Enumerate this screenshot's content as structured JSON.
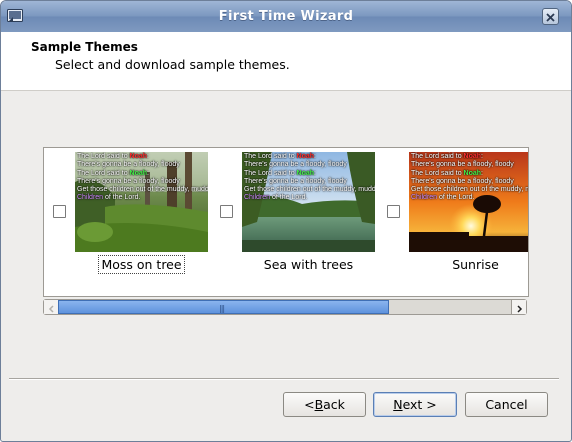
{
  "window": {
    "title": "First Time Wizard",
    "title_icon": "window-icon",
    "close_icon": "close-icon"
  },
  "header": {
    "title": "Sample Themes",
    "subtitle": "Select and download sample themes."
  },
  "themes": [
    {
      "name": "Moss on tree",
      "checked": false,
      "focused": true,
      "lyrics": [
        {
          "parts": [
            {
              "t": "The Lord said to "
            },
            {
              "t": "Noah",
              "c": "red"
            },
            {
              "t": ":"
            }
          ]
        },
        {
          "parts": [
            {
              "t": "There's gonna be a "
            },
            {
              "t": "floody, floody"
            }
          ]
        },
        {
          "parts": [
            {
              "t": "The Lord said to "
            },
            {
              "t": "Noah",
              "c": "green"
            },
            {
              "t": ":"
            }
          ]
        },
        {
          "parts": [
            {
              "t": "There's gonna be a "
            },
            {
              "t": "floody, floody"
            }
          ]
        },
        {
          "parts": [
            {
              "t": "Get those children out of the muddy, muddy"
            }
          ]
        },
        {
          "parts": [
            {
              "t": "Children",
              "c": "purple"
            },
            {
              "t": " of the Lord."
            }
          ]
        }
      ]
    },
    {
      "name": "Sea with trees",
      "checked": false,
      "focused": false,
      "lyrics": [
        {
          "parts": [
            {
              "t": "The Lord said to "
            },
            {
              "t": "Noah",
              "c": "red"
            },
            {
              "t": ":"
            }
          ]
        },
        {
          "parts": [
            {
              "t": "There's gonna be a "
            },
            {
              "t": "floody, floody"
            }
          ]
        },
        {
          "parts": [
            {
              "t": "The Lord said to "
            },
            {
              "t": "Noah",
              "c": "green"
            },
            {
              "t": ":"
            }
          ]
        },
        {
          "parts": [
            {
              "t": "There's gonna be a "
            },
            {
              "t": "floody, floody"
            }
          ]
        },
        {
          "parts": [
            {
              "t": "Get those children out of the muddy, muddy"
            }
          ]
        },
        {
          "parts": [
            {
              "t": "Children",
              "c": "purple"
            },
            {
              "t": " of the Lord."
            }
          ]
        }
      ]
    },
    {
      "name": "Sunrise",
      "checked": false,
      "focused": false,
      "lyrics": [
        {
          "parts": [
            {
              "t": "The Lord said to "
            },
            {
              "t": "Noah",
              "c": "red"
            },
            {
              "t": ":"
            }
          ]
        },
        {
          "parts": [
            {
              "t": "There's gonna be a "
            },
            {
              "t": "floody, floody"
            }
          ]
        },
        {
          "parts": [
            {
              "t": "The Lord said to "
            },
            {
              "t": "Noah",
              "c": "green"
            },
            {
              "t": ":"
            }
          ]
        },
        {
          "parts": [
            {
              "t": "There's gonna be a "
            },
            {
              "t": "floody, floody"
            }
          ]
        },
        {
          "parts": [
            {
              "t": "Get those children out of the muddy, muddy"
            }
          ]
        },
        {
          "parts": [
            {
              "t": "Children",
              "c": "purple"
            },
            {
              "t": " of the Lord."
            }
          ]
        }
      ]
    }
  ],
  "scrollbar": {
    "left_icon": "chevron-left-icon",
    "right_icon": "chevron-right-icon",
    "grip_icon": "grip-icon",
    "thumb_color": "#6fa0e4"
  },
  "buttons": {
    "back_mnemonic": "B",
    "back_rest": "ack",
    "back_prefix": "< ",
    "next_mnemonic": "N",
    "next_rest": "ext >",
    "cancel": "Cancel"
  },
  "colors": {
    "titlebar": "#7c98c0",
    "dialog_bg": "#eeedeb",
    "accent": "#5f93dd"
  }
}
